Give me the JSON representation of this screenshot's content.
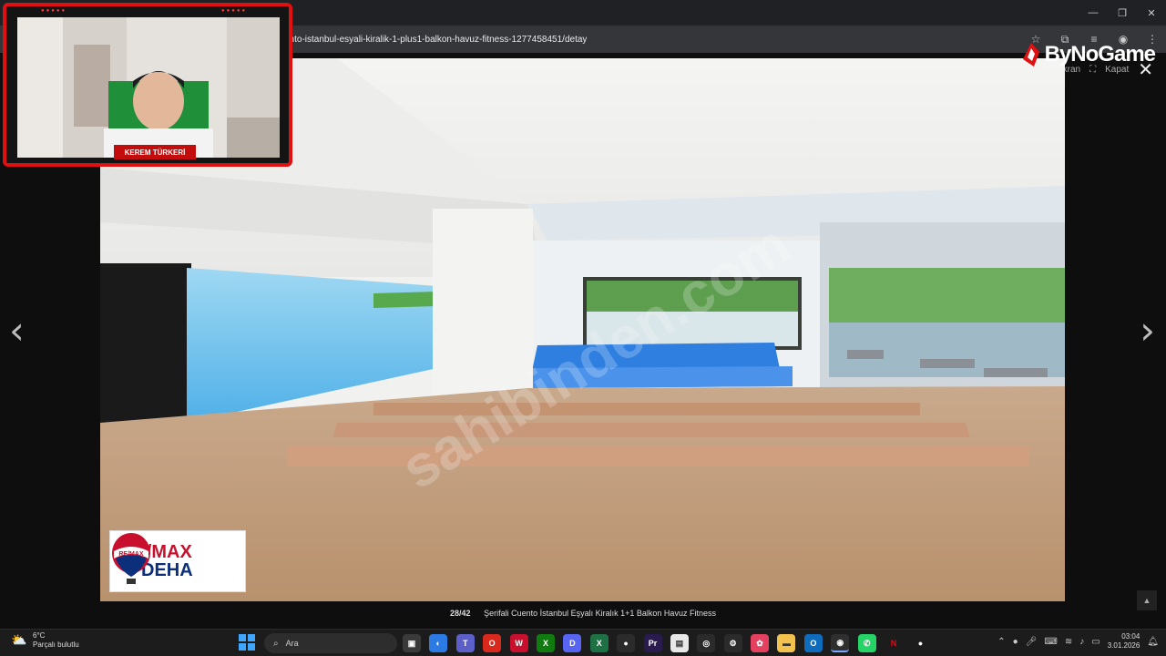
{
  "browser": {
    "url": "ento-istanbul-esyali-kiralik-1-plus1-balkon-havuz-fitness-1277458451/detay"
  },
  "gallery": {
    "top_labels": [
      "Ekran",
      "Kapat"
    ],
    "watermark": "sahibinden.com",
    "counter": "28/42",
    "caption": "Şerifali Cuento İstanbul Eşyalı Kiralık 1+1 Balkon Havuz Fitness",
    "logo": {
      "brand": "RE/MAX",
      "office": "DEHA",
      "badge": "RE/MAX"
    }
  },
  "stream": {
    "streamer_name": "KEREM TÜRKERİ",
    "brand": "ByNoGame"
  },
  "taskbar": {
    "weather_temp": "6°C",
    "weather_desc": "Parçalı bulutlu",
    "search_placeholder": "Ara",
    "time": "03:04",
    "date": "3.01.2026"
  },
  "colors": {
    "accent_red": "#e01010",
    "remax_red": "#c8102e",
    "remax_blue": "#0b2f7a",
    "pool_blue": "#2f7fe0"
  }
}
